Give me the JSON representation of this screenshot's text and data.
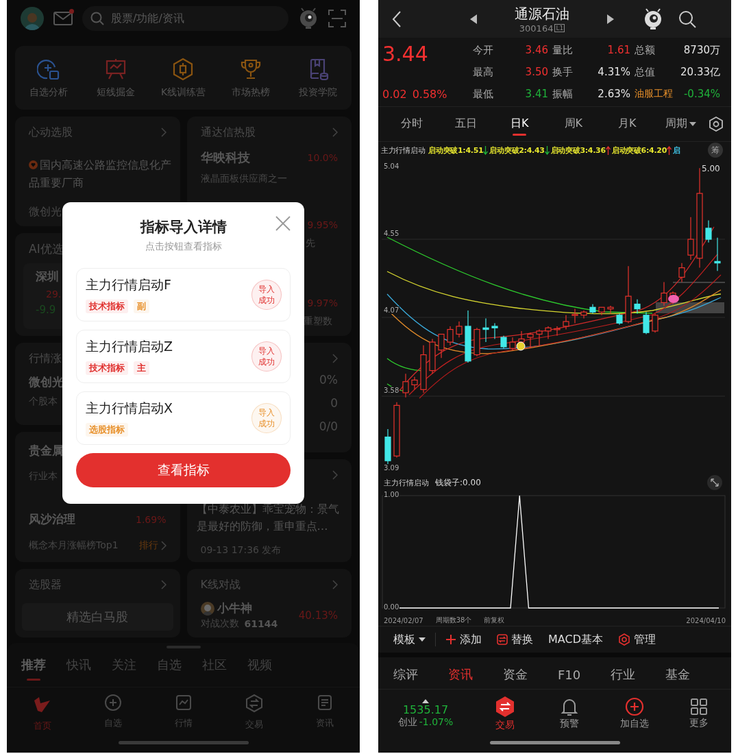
{
  "left_screen": {
    "top_bar": {
      "search_placeholder": "股票/功能/资讯",
      "mail_unread": true
    },
    "shortcuts": [
      {
        "kind": "analysis",
        "label": "自选分析"
      },
      {
        "kind": "board",
        "label": "短线掘金"
      },
      {
        "kind": "kline",
        "label": "K线训练营"
      },
      {
        "kind": "trophy",
        "label": "市场热榜"
      },
      {
        "kind": "book",
        "label": "投资学院"
      }
    ],
    "pick_card": {
      "title": "心动选股",
      "headline": "国内高速公路监控信息化产品重要厂商",
      "stock": "微创光"
    },
    "ai_card": {
      "title": "AI优选",
      "stock": "深圳",
      "price": "29.",
      "change": "-9.9"
    },
    "trend_card": {
      "title": "行情涨",
      "stock": "微创光",
      "note": "个股本"
    },
    "metal_card": {
      "title": "贵金属",
      "note": "行业本",
      "concept": "风沙治理",
      "concept_change": "1.69%",
      "concept_note": "概念本月涨幅榜Top1",
      "link": "排行"
    },
    "screener_card": {
      "title": "选股器",
      "button": "精选白马股"
    },
    "hot_card": {
      "title": "通达信热股",
      "stock": "华映科技",
      "change": "10.0%",
      "desc": "液晶面板供应商之一",
      "more": [
        {
          "change": "9.95%",
          "desc": "先"
        },
        {
          "change": "9.97%",
          "desc": "重塑数"
        }
      ]
    },
    "stats_card": {
      "values": [
        "0%",
        "0",
        "0/0"
      ]
    },
    "news_card": {
      "text": "【中泰农业】乖宝宠物：景气是最好的防御，重申重点…",
      "time": "09-13 17:36 发布"
    },
    "battle_card": {
      "title": "K线对战",
      "user": "小牛神",
      "count_label": "对战次数",
      "count": "61144",
      "return": "40.13%"
    },
    "feed_tabs": [
      {
        "label": "推荐",
        "selected": true
      },
      {
        "label": "快讯",
        "selected": false
      },
      {
        "label": "关注",
        "selected": false
      },
      {
        "label": "自选",
        "selected": false
      },
      {
        "label": "社区",
        "selected": false
      },
      {
        "label": "视频",
        "selected": false
      }
    ],
    "nav": [
      {
        "kind": "home",
        "label": "首页",
        "selected": true
      },
      {
        "kind": "add",
        "label": "自选",
        "selected": false
      },
      {
        "kind": "chart",
        "label": "行情",
        "selected": false
      },
      {
        "kind": "trade",
        "label": "交易",
        "selected": false
      },
      {
        "kind": "news",
        "label": "资讯",
        "selected": false
      }
    ],
    "dialog": {
      "title": "指标导入详情",
      "subtitle": "点击按钮查看指标",
      "items": [
        {
          "name": "主力行情启动F",
          "tags": [
            {
              "label": "技术指标",
              "color": "#e0312f"
            },
            {
              "label": "副",
              "color": "#e8902a"
            }
          ],
          "status": "导入成功",
          "color": "#e0312f"
        },
        {
          "name": "主力行情启动Z",
          "tags": [
            {
              "label": "技术指标",
              "color": "#e0312f"
            },
            {
              "label": "主",
              "color": "#e0312f"
            }
          ],
          "status": "导入成功",
          "color": "#e0312f"
        },
        {
          "name": "主力行情启动X",
          "tags": [
            {
              "label": "选股指标",
              "color": "#e8902a"
            }
          ],
          "status": "导入成功",
          "color": "#e8902a"
        }
      ],
      "button": "查看指标"
    }
  },
  "right_screen": {
    "header": {
      "title": "通源石油",
      "code": "300164",
      "level_badge": "L1"
    },
    "quote": {
      "price": "3.44",
      "change": "0.02",
      "change_pct": "0.58%",
      "color": "#f23030"
    },
    "stats": [
      {
        "kind": "stat",
        "label": "今开",
        "value": "3.46",
        "color": "#f23030"
      },
      {
        "kind": "stat",
        "label": "量比",
        "value": "1.61",
        "color": "#f23030"
      },
      {
        "kind": "stat",
        "label": "总额",
        "value": "8730万",
        "color": "#e6e6e6"
      },
      {
        "kind": "stat",
        "label": "最高",
        "value": "3.50",
        "color": "#f23030"
      },
      {
        "kind": "stat",
        "label": "换手",
        "value": "4.31%",
        "color": "#e6e6e6"
      },
      {
        "kind": "stat",
        "label": "总值",
        "value": "20.33亿",
        "color": "#e6e6e6"
      },
      {
        "kind": "stat",
        "label": "最低",
        "value": "3.41",
        "color": "#1fb33a"
      },
      {
        "kind": "stat",
        "label": "振幅",
        "value": "2.63%",
        "color": "#e6e6e6"
      },
      {
        "kind": "sector",
        "label": "油服工程",
        "value": "-0.34%",
        "color": "#1fb33a"
      }
    ],
    "periods": [
      {
        "label": "分时",
        "selected": false,
        "dropdown": false
      },
      {
        "label": "五日",
        "selected": false,
        "dropdown": false
      },
      {
        "label": "日K",
        "selected": true,
        "dropdown": false
      },
      {
        "label": "周K",
        "selected": false,
        "dropdown": false
      },
      {
        "label": "月K",
        "selected": false,
        "dropdown": false
      },
      {
        "label": "周期",
        "selected": false,
        "dropdown": true
      }
    ],
    "indicator_legend": {
      "name": "主力行情启动",
      "badge": "筹",
      "items": [
        {
          "label": "启动突破1:4.51",
          "arrow_up": false,
          "color": "#e6e62e"
        },
        {
          "label": "启动突破2:4.43",
          "arrow_up": false,
          "color": "#e6e62e"
        },
        {
          "label": "启动突破3:4.36",
          "arrow_up": true,
          "color": "#e6e62e"
        },
        {
          "label": "启动突破6:4.20",
          "arrow_up": true,
          "color": "#e6e62e"
        },
        {
          "label": "启",
          "color": "#3ec3e6"
        }
      ]
    },
    "price_chart": {
      "y_labels": [
        "5.04",
        "4.55",
        "4.07",
        "3.58",
        "3.09"
      ],
      "high_label": "5.00"
    },
    "sub_chart": {
      "legend_name": "主力行情启动",
      "legend_value": "钱袋子:0.00",
      "chart_data": {
        "type": "line",
        "ylim": [
          0,
          1
        ],
        "yticks": [
          {
            "value": 0,
            "label": "0.00"
          },
          {
            "value": 1,
            "label": "1.00"
          }
        ],
        "series": [
          {
            "color": "#ffffff",
            "values": [
              0,
              0,
              0,
              0,
              0,
              0,
              0,
              0,
              0,
              0,
              0,
              0,
              0,
              0,
              0,
              1,
              0,
              0,
              0,
              0,
              0,
              0,
              0,
              0,
              0,
              0,
              0,
              0,
              0,
              0,
              0,
              0,
              0,
              0,
              0,
              0,
              0,
              0
            ]
          }
        ]
      },
      "footer": [
        "2024/02/07",
        "周期数38个",
        "前复权"
      ],
      "end_date": "2024/04/10"
    },
    "toolbar": [
      {
        "kind": "dropdown",
        "label": "模板"
      },
      {
        "kind": "add",
        "label": "添加"
      },
      {
        "kind": "swap",
        "label": "替换"
      },
      {
        "kind": "plain",
        "label": "MACD基本"
      },
      {
        "kind": "manage",
        "label": "管理"
      }
    ],
    "tabs": [
      {
        "label": "综评",
        "selected": false
      },
      {
        "label": "资讯",
        "selected": true
      },
      {
        "label": "资金",
        "selected": false
      },
      {
        "label": "F10",
        "selected": false
      },
      {
        "label": "行业",
        "selected": false
      },
      {
        "label": "基金",
        "selected": false
      }
    ],
    "index": {
      "value": "1535.17",
      "name": "创业",
      "change": "-1.07%"
    },
    "actions": [
      {
        "kind": "trade",
        "label": "交易",
        "highlighted": true
      },
      {
        "kind": "alert",
        "label": "预警",
        "highlighted": false
      },
      {
        "kind": "add",
        "label": "加自选",
        "highlighted": false
      },
      {
        "kind": "more",
        "label": "更多",
        "highlighted": false
      }
    ]
  }
}
